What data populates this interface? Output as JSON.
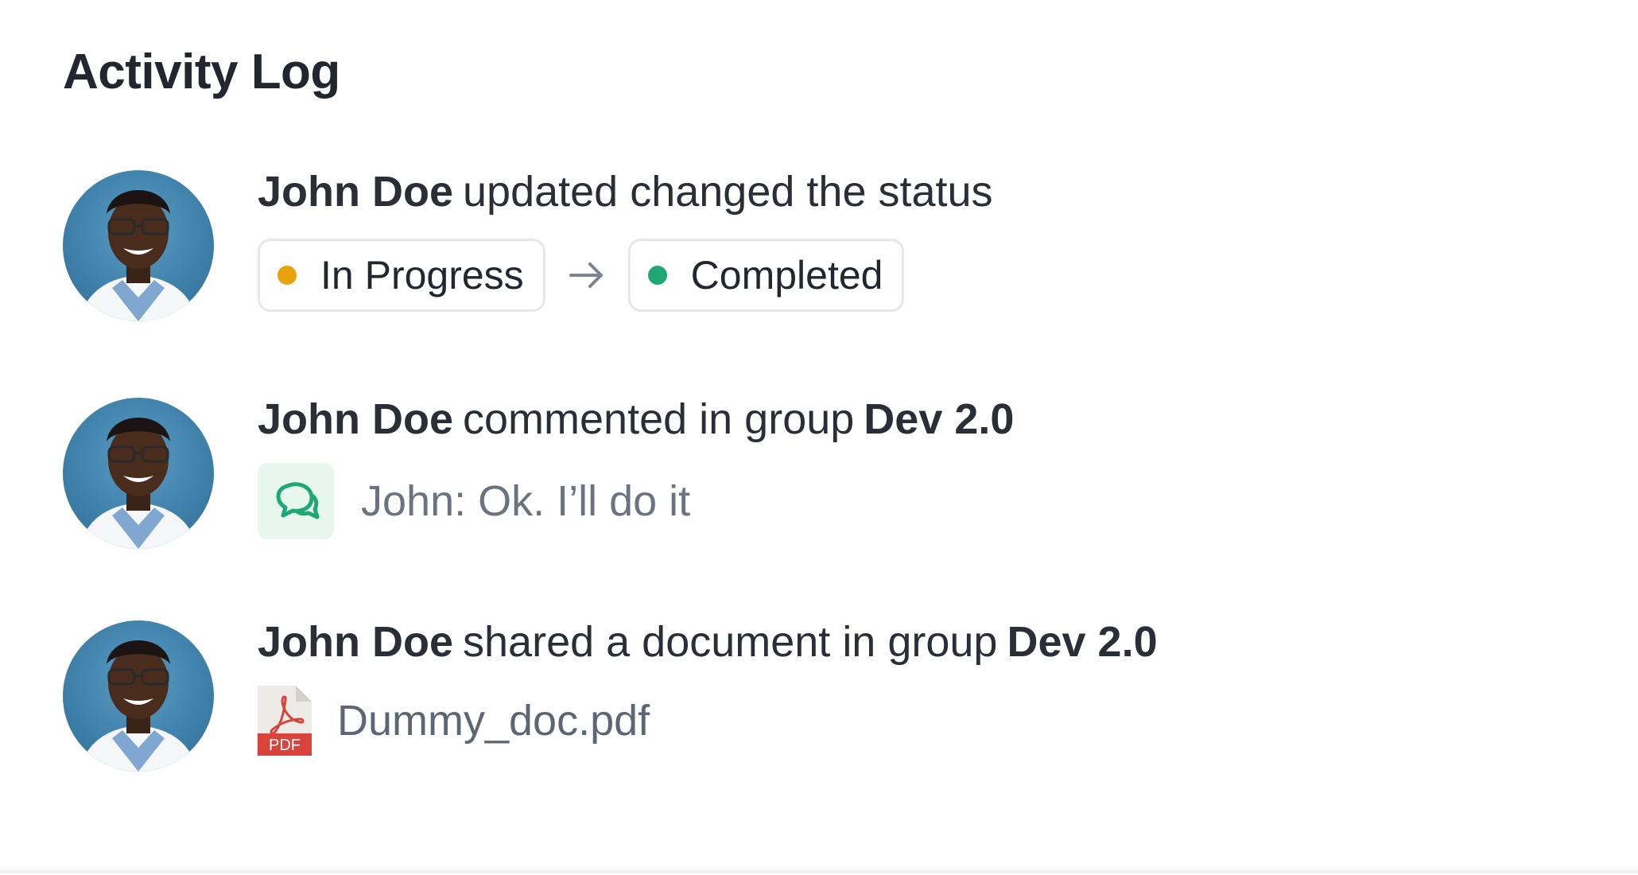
{
  "header": {
    "title": "Activity Log"
  },
  "activities": [
    {
      "actor": "John  Doe",
      "action": "updated changed the status",
      "status_from": {
        "label": "In Progress",
        "color": "#e8a20c"
      },
      "status_to": {
        "label": "Completed",
        "color": "#1fa876"
      }
    },
    {
      "actor": "John  Doe",
      "action": "commented in group",
      "group": "Dev 2.0",
      "comment": "John: Ok. I’ll do it",
      "icon": "chat-icon"
    },
    {
      "actor": "John  Doe",
      "action": "shared a document in group",
      "group": "Dev 2.0",
      "document": "Dummy_doc.pdf",
      "document_badge": "PDF",
      "icon": "pdf-file-icon"
    }
  ],
  "colors": {
    "title": "#23262f",
    "muted_text": "#6b7280",
    "chat_bg": "#e7f6ef",
    "chat_icon": "#1fa876",
    "pdf_red": "#d8433b"
  }
}
